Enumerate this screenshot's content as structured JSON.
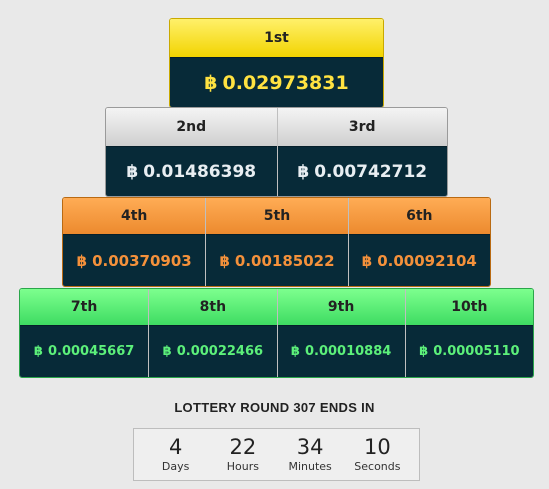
{
  "prizes": {
    "tier1": [
      {
        "rank": "1st",
        "amount": "0.02973831"
      }
    ],
    "tier2": [
      {
        "rank": "2nd",
        "amount": "0.01486398"
      },
      {
        "rank": "3rd",
        "amount": "0.00742712"
      }
    ],
    "tier3": [
      {
        "rank": "4th",
        "amount": "0.00370903"
      },
      {
        "rank": "5th",
        "amount": "0.00185022"
      },
      {
        "rank": "6th",
        "amount": "0.00092104"
      }
    ],
    "tier4": [
      {
        "rank": "7th",
        "amount": "0.00045667"
      },
      {
        "rank": "8th",
        "amount": "0.00022466"
      },
      {
        "rank": "9th",
        "amount": "0.00010884"
      },
      {
        "rank": "10th",
        "amount": "0.00005110"
      }
    ]
  },
  "currency_symbol": "฿",
  "colors": {
    "gold": "#f2d400",
    "silver": "#cfcfcf",
    "bronze": "#ec8a2e",
    "green": "#3edc62",
    "panel_bg": "#072a38"
  },
  "lottery": {
    "title": "LOTTERY ROUND 307 ENDS IN",
    "countdown": [
      {
        "value": "4",
        "label": "Days"
      },
      {
        "value": "22",
        "label": "Hours"
      },
      {
        "value": "34",
        "label": "Minutes"
      },
      {
        "value": "10",
        "label": "Seconds"
      }
    ]
  }
}
